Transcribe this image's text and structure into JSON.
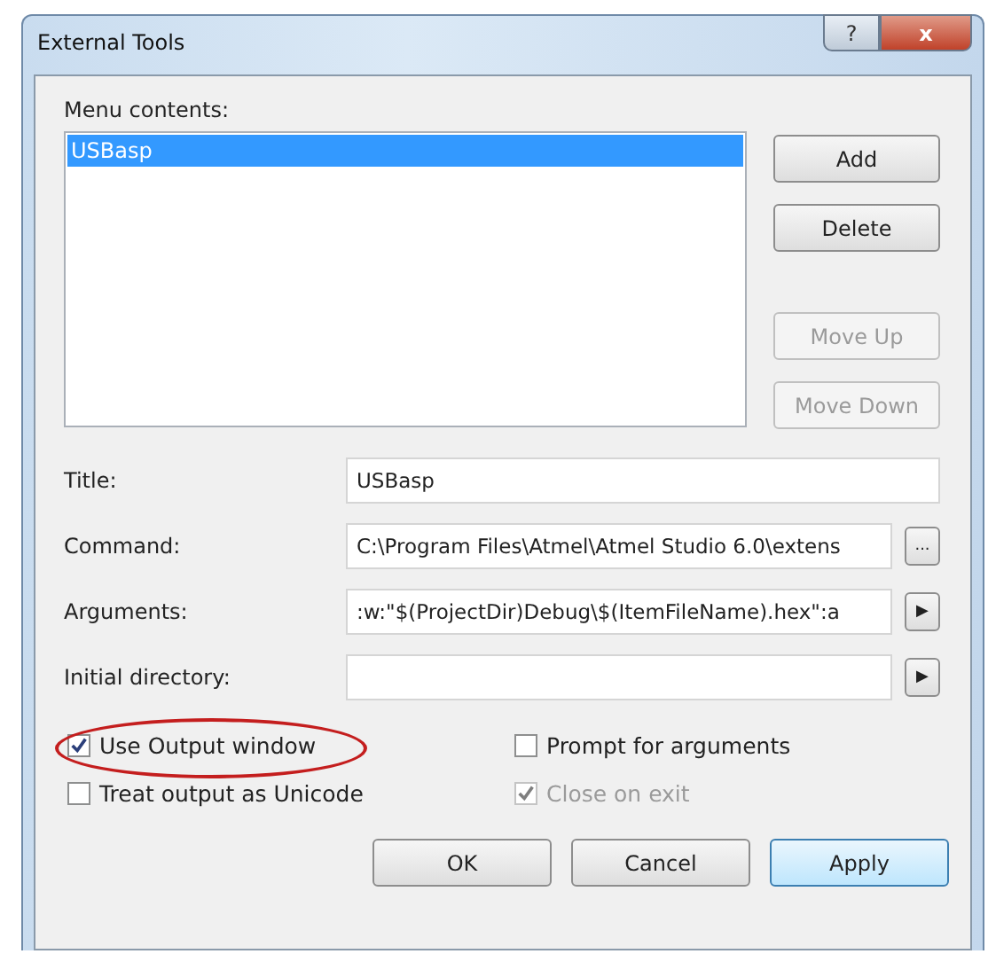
{
  "window": {
    "title": "External Tools",
    "help_button": "?",
    "close_button": "x"
  },
  "menu_contents": {
    "label": "Menu contents:",
    "items": [
      {
        "label": "USBasp",
        "selected": true
      }
    ]
  },
  "side_buttons": [
    {
      "label": "Add",
      "disabled": false
    },
    {
      "label": "Delete",
      "disabled": false
    },
    {
      "label": "Move Up",
      "disabled": true
    },
    {
      "label": "Move Down",
      "disabled": true
    }
  ],
  "fields": [
    {
      "label": "Title:",
      "value": "USBasp"
    },
    {
      "label": "Command:",
      "value": "C:\\Program Files\\Atmel\\Atmel Studio 6.0\\extens",
      "button": "..."
    },
    {
      "label": "Arguments:",
      "value": ":w:\"$(ProjectDir)Debug\\$(ItemFileName).hex\":a",
      "button": "▶"
    },
    {
      "label": "Initial directory:",
      "button": "▶"
    }
  ],
  "options": [
    {
      "label": "Use Output window",
      "checked": true,
      "disabled": false,
      "highlighted": true
    },
    {
      "label": "Prompt for arguments",
      "checked": false,
      "disabled": false,
      "highlighted": false
    },
    {
      "label": "Treat output as Unicode",
      "checked": false,
      "disabled": false,
      "highlighted": false
    },
    {
      "label": "Close on exit",
      "checked": true,
      "disabled": true,
      "highlighted": false
    }
  ],
  "buttons": [
    {
      "label": "OK",
      "default": false
    },
    {
      "label": "Cancel",
      "default": false
    },
    {
      "label": "Apply",
      "default": true
    }
  ]
}
